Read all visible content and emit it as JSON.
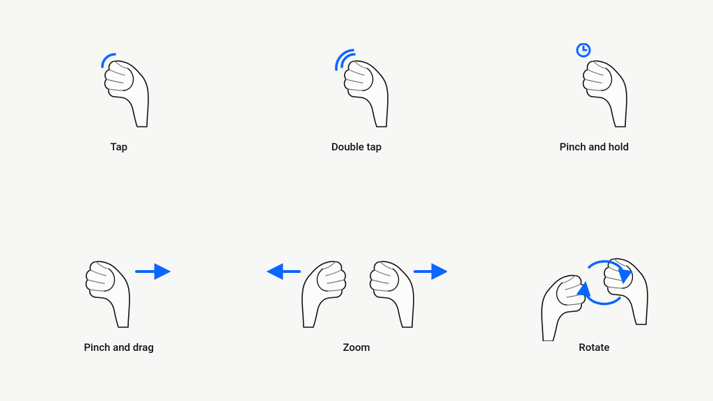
{
  "accent": "#0a66ff",
  "gestures": [
    {
      "id": "tap",
      "label": "Tap"
    },
    {
      "id": "double-tap",
      "label": "Double tap"
    },
    {
      "id": "pinch-and-hold",
      "label": "Pinch and hold"
    },
    {
      "id": "pinch-and-drag",
      "label": "Pinch and drag"
    },
    {
      "id": "zoom",
      "label": "Zoom"
    },
    {
      "id": "rotate",
      "label": "Rotate"
    }
  ]
}
